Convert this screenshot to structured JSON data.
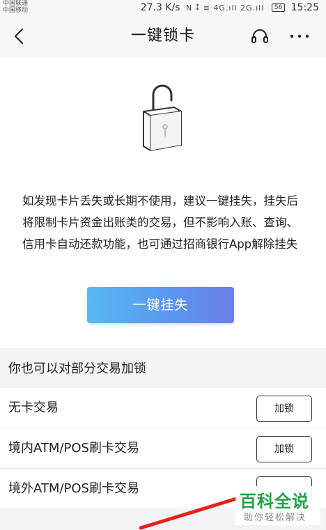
{
  "status_bar": {
    "carrier_1": "中国联通",
    "carrier_2": "中国移动",
    "speed": "27.3 K/s",
    "icons_text": "N ⁑ ≋ 4G.ıll 2G.ıll",
    "battery": "56",
    "time": "15:25"
  },
  "nav": {
    "title": "一键锁卡",
    "back_icon": "chevron-left-icon",
    "service_icon": "headset-icon",
    "more_icon": "more-dots-icon"
  },
  "main": {
    "illustration_icon": "padlock-unlocked-icon",
    "description": "如发现卡片丢失或长期不使用，建议一键挂失，挂失后将限制卡片资金出账类的交易，但不影响入账、查询、信用卡自动还款功能，也可通过招商银行App解除挂失",
    "report_button": "一键挂失"
  },
  "partial_lock": {
    "title": "你也可以对部分交易加锁",
    "rows": [
      {
        "label": "无卡交易",
        "button": "加锁"
      },
      {
        "label": "境内ATM/POS刷卡交易",
        "button": "加锁"
      },
      {
        "label": "境外ATM/POS刷卡交易",
        "button": ""
      }
    ]
  },
  "watermark": {
    "title": "百科全说",
    "subtitle": "助你轻松解决"
  },
  "colors": {
    "button_gradient_start": "#58b8f3",
    "button_gradient_end": "#6b7ee8",
    "watermark_green": "#21a344",
    "annotation_red": "#e8201c"
  }
}
